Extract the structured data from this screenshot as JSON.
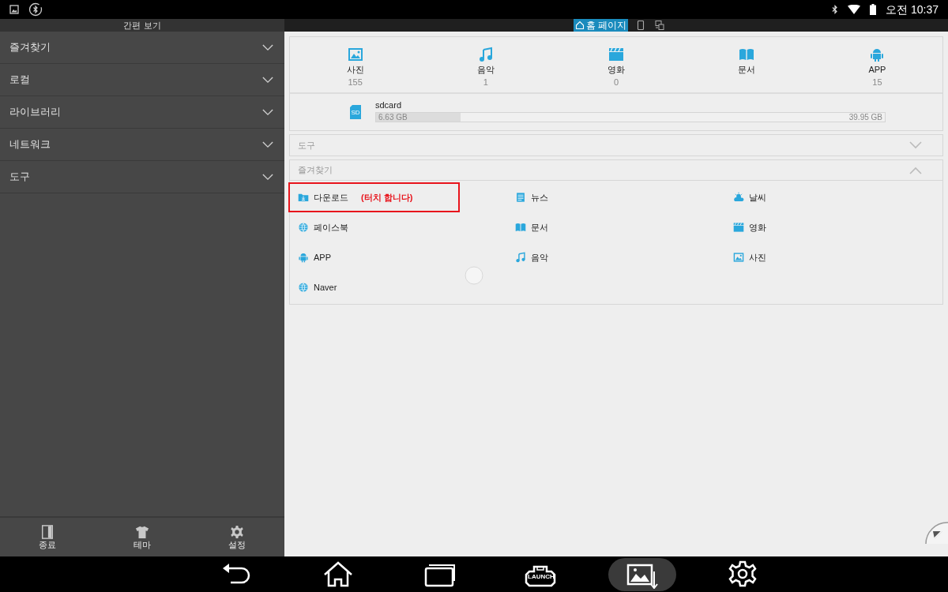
{
  "status_bar": {
    "time": "오전 10:37"
  },
  "sidebar": {
    "title": "간편 보기",
    "items": [
      {
        "label": "즐겨찾기",
        "expanded": false
      },
      {
        "label": "로컬",
        "expanded": false
      },
      {
        "label": "라이브러리",
        "expanded": false
      },
      {
        "label": "네트워크",
        "expanded": false
      },
      {
        "label": "도구",
        "expanded": false
      }
    ],
    "bottom_buttons": [
      {
        "kind": "exit",
        "label": "종료"
      },
      {
        "kind": "theme",
        "label": "테마"
      },
      {
        "kind": "settings",
        "label": "설정"
      }
    ]
  },
  "tabs": [
    {
      "kind": "home",
      "label": "홈 페이지",
      "selected": true
    },
    {
      "kind": "phone",
      "selected": false
    },
    {
      "kind": "devices",
      "selected": false
    }
  ],
  "categories": [
    {
      "kind": "image",
      "label": "사진",
      "count": "155"
    },
    {
      "kind": "music",
      "label": "음악",
      "count": "1"
    },
    {
      "kind": "movie",
      "label": "영화",
      "count": "0"
    },
    {
      "kind": "book",
      "label": "문서"
    },
    {
      "kind": "android",
      "label": "APP",
      "count": "15"
    }
  ],
  "storage": {
    "icon_label": "SD",
    "name": "sdcard",
    "used": "6.63 GB",
    "total": "39.95 GB",
    "level": 0.166
  },
  "sections": [
    {
      "title": "도구",
      "expanded": false
    },
    {
      "title": "즐겨찾기",
      "expanded": true,
      "items": [
        {
          "kind": "download",
          "label": "다운로드",
          "highlighted": true,
          "note": "(터치 합니다)"
        },
        {
          "kind": "news",
          "label": "뉴스",
          "highlighted": false
        },
        {
          "kind": "weather",
          "label": "날씨",
          "highlighted": false
        },
        {
          "kind": "globe",
          "label": "페이스북",
          "highlighted": false
        },
        {
          "kind": "book",
          "label": "문서",
          "highlighted": false
        },
        {
          "kind": "movie",
          "label": "영화",
          "highlighted": false
        },
        {
          "kind": "android",
          "label": "APP",
          "highlighted": false
        },
        {
          "kind": "music",
          "label": "음악",
          "highlighted": false
        },
        {
          "kind": "image",
          "label": "사진",
          "highlighted": false
        },
        {
          "kind": "globe",
          "label": "Naver",
          "highlighted": false
        }
      ]
    }
  ],
  "nav_bar": [
    {
      "kind": "back",
      "selected": false
    },
    {
      "kind": "home",
      "selected": false
    },
    {
      "kind": "recents",
      "selected": false
    },
    {
      "kind": "launch",
      "label": "LAUNCH",
      "selected": false
    },
    {
      "kind": "screenshot",
      "selected": true
    },
    {
      "kind": "settings",
      "selected": false
    }
  ]
}
